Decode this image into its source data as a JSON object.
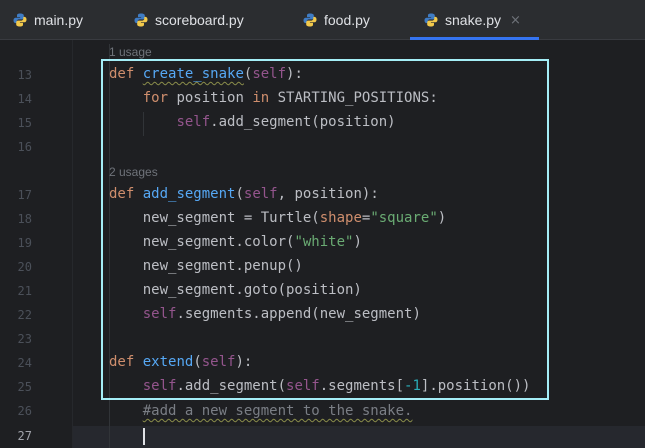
{
  "tabs": [
    {
      "label": "main.py",
      "active": false
    },
    {
      "label": "scoreboard.py",
      "active": false
    },
    {
      "label": "food.py",
      "active": false
    },
    {
      "label": "snake.py",
      "active": true,
      "close": "×"
    }
  ],
  "hints": {
    "create_snake": "1 usage",
    "add_segment": "2 usages"
  },
  "line_numbers": [
    "13",
    "14",
    "15",
    "16",
    "17",
    "18",
    "19",
    "20",
    "21",
    "22",
    "23",
    "24",
    "25",
    "26",
    "27"
  ],
  "code": {
    "l13": {
      "kw": "def",
      "fn": "create_snake",
      "open": "(",
      "self": "self",
      "close": "):"
    },
    "l14": {
      "kw1": "for",
      "mid": " position ",
      "kw2": "in",
      "rest": " STARTING_POSITIONS:"
    },
    "l15": {
      "self": "self",
      "rest": ".add_segment(position)"
    },
    "l17": {
      "kw": "def",
      "fn": "add_segment",
      "open": "(",
      "self": "self",
      "rest": ", position):"
    },
    "l18": {
      "pre": "new_segment = Turtle(",
      "param": "shape",
      "eq": "=",
      "str": "\"square\"",
      "close": ")"
    },
    "l19": {
      "pre": "new_segment.color(",
      "str": "\"white\"",
      "close": ")"
    },
    "l20": {
      "text": "new_segment.penup()"
    },
    "l21": {
      "text": "new_segment.goto(position)"
    },
    "l22": {
      "self": "self",
      "rest": ".segments.append(new_segment)"
    },
    "l24": {
      "kw": "def",
      "fn": "extend",
      "open": "(",
      "self": "self",
      "close": "):"
    },
    "l25": {
      "self1": "self",
      "mid": ".add_segment(",
      "self2": "self",
      "seg": ".segments[",
      "num": "-1",
      "end": "].position())"
    },
    "l26": {
      "comment": "#add a new segment to the snake."
    }
  },
  "colors": {
    "background": "#1e1f22",
    "tabbar": "#2b2d30",
    "accent": "#3574f0",
    "selection_box": "#a5eef7",
    "keyword": "#cf8e6d",
    "function": "#56a8f5",
    "self": "#94558d",
    "string": "#6aab73",
    "number": "#2aacb8",
    "comment": "#7a7e85",
    "python_icon_blue": "#3f7cc4",
    "python_icon_yellow": "#f2c94c"
  },
  "icons": {
    "file_type": "python-file-icon",
    "close": "close-icon"
  }
}
